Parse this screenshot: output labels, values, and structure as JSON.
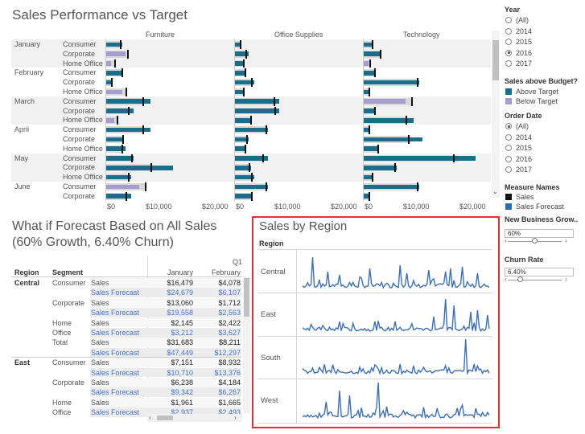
{
  "performance": {
    "title": "Sales Performance vs Target",
    "categories": [
      "Furniture",
      "Office Supplies",
      "Technology"
    ],
    "months": [
      "January",
      "February",
      "March",
      "April",
      "May",
      "June"
    ],
    "segments": [
      "Consumer",
      "Corporate",
      "Home Office"
    ],
    "axis_ticks": [
      "$0",
      "$10,000",
      "$20,000"
    ],
    "colors": {
      "above_target": "#1b6e8a",
      "below_target": "#a59ccf",
      "target_band": "#d9d9d9",
      "target_line": "#111111"
    }
  },
  "filters": {
    "year": {
      "label": "Year",
      "options": [
        "(All)",
        "2014",
        "2015",
        "2016",
        "2017"
      ],
      "selected": "2016"
    },
    "sales_above_budget": {
      "label": "Sales above Budget?",
      "items": [
        "Above Target",
        "Below Target"
      ],
      "colors": [
        "#1b6e8a",
        "#a59ccf"
      ]
    },
    "order_date": {
      "label": "Order Date",
      "options": [
        "(All)",
        "2014",
        "2015",
        "2016",
        "2017"
      ],
      "selected": "(All)"
    },
    "measure_names": {
      "label": "Measure Names",
      "items": [
        "Sales",
        "Sales Forecast"
      ],
      "colors": [
        "#111111",
        "#2a6fb0"
      ]
    },
    "new_business_growth": {
      "label": "New Business Grow..",
      "value": "60%",
      "level": 0.5
    },
    "churn_rate": {
      "label": "Churn Rate",
      "value": "6.40%",
      "level": 0.2
    }
  },
  "forecast": {
    "title_line1": "What if Forecast Based on All Sales",
    "title_line2": "(60% Growth, 6.40% Churn)",
    "quarter": "Q1",
    "headers": {
      "region": "Region",
      "segment": "Segment",
      "jan": "January",
      "feb": "February"
    },
    "rows": [
      {
        "region": "Central",
        "segment": "Consumer",
        "measure": "Sales",
        "jan": "$16,479",
        "feb": "$4,078",
        "forecast": false
      },
      {
        "region": "",
        "segment": "",
        "measure": "Sales Forecast",
        "jan": "$24,679",
        "feb": "$6,107",
        "forecast": true
      },
      {
        "region": "",
        "segment": "Corporate",
        "measure": "Sales",
        "jan": "$13,060",
        "feb": "$1,712",
        "forecast": false
      },
      {
        "region": "",
        "segment": "",
        "measure": "Sales Forecast",
        "jan": "$19,558",
        "feb": "$2,563",
        "forecast": true
      },
      {
        "region": "",
        "segment": "Home",
        "measure": "Sales",
        "jan": "$2,145",
        "feb": "$2,422",
        "forecast": false
      },
      {
        "region": "",
        "segment": "Office",
        "measure": "Sales Forecast",
        "jan": "$3,212",
        "feb": "$3,627",
        "forecast": true
      },
      {
        "region": "",
        "segment": "Total",
        "measure": "Sales",
        "jan": "$31,683",
        "feb": "$8,211",
        "forecast": false,
        "total": true
      },
      {
        "region": "",
        "segment": "",
        "measure": "Sales Forecast",
        "jan": "$47,449",
        "feb": "$12,297",
        "forecast": true,
        "total": true
      },
      {
        "region": "East",
        "segment": "Consumer",
        "measure": "Sales",
        "jan": "$7,151",
        "feb": "$8,932",
        "forecast": false
      },
      {
        "region": "",
        "segment": "",
        "measure": "Sales Forecast",
        "jan": "$10,710",
        "feb": "$13,376",
        "forecast": true
      },
      {
        "region": "",
        "segment": "Corporate",
        "measure": "Sales",
        "jan": "$6,238",
        "feb": "$4,184",
        "forecast": false
      },
      {
        "region": "",
        "segment": "",
        "measure": "Sales Forecast",
        "jan": "$9,342",
        "feb": "$6,267",
        "forecast": true
      },
      {
        "region": "",
        "segment": "Home",
        "measure": "Sales",
        "jan": "$1,961",
        "feb": "$1,665",
        "forecast": false
      },
      {
        "region": "",
        "segment": "Office",
        "measure": "Sales Forecast",
        "jan": "$2,937",
        "feb": "$2,493",
        "forecast": true
      }
    ]
  },
  "region_chart": {
    "title": "Sales by Region",
    "header": "Region",
    "regions": [
      "Central",
      "East",
      "South",
      "West"
    ],
    "line_color": "#3d6fb0"
  }
}
